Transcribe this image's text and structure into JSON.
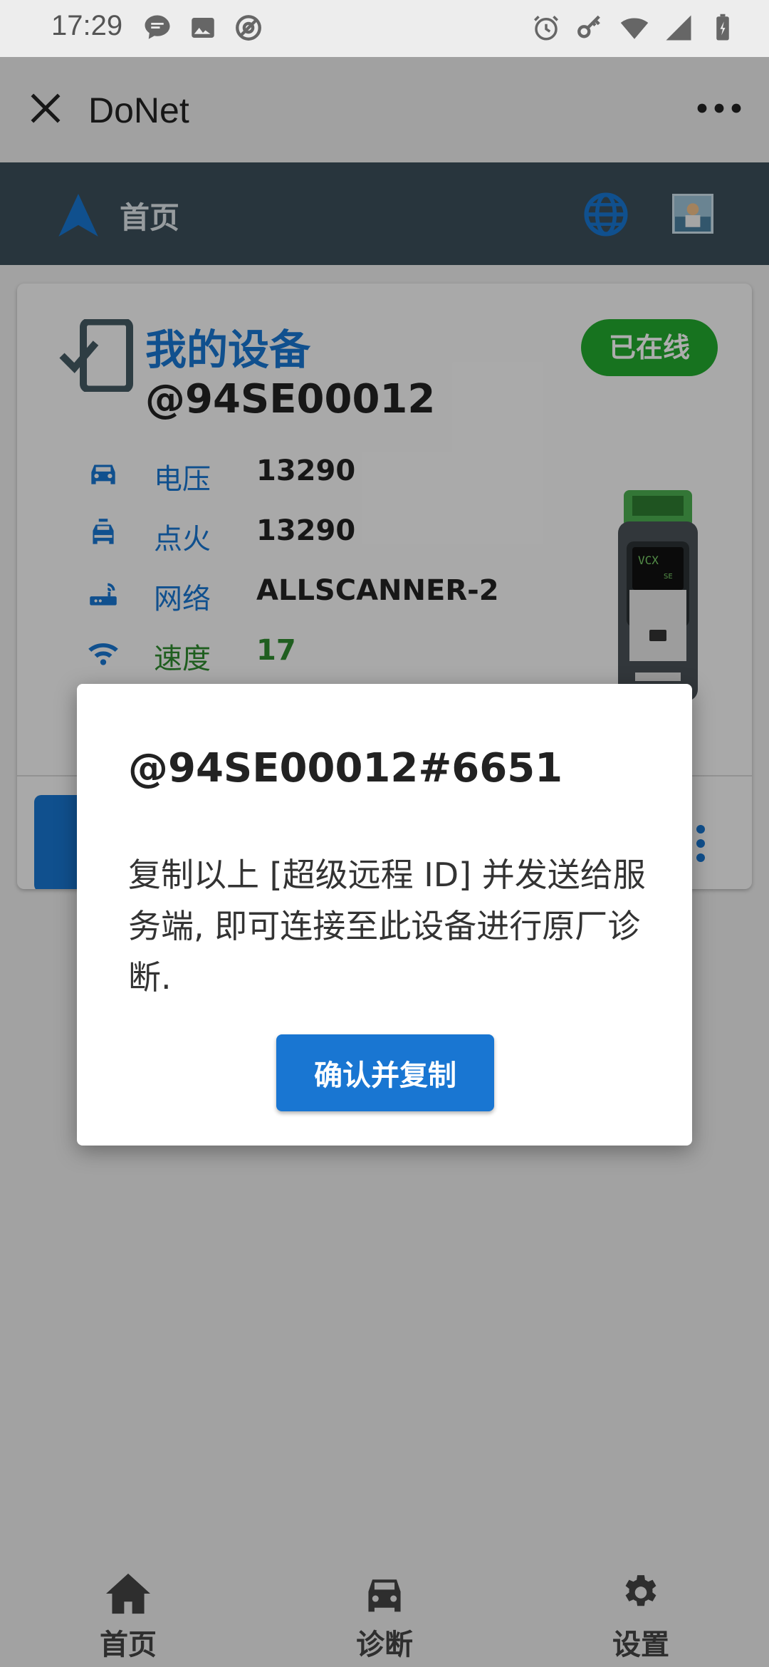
{
  "status_bar": {
    "time": "17:29",
    "left_icons": [
      "chat-bubble-icon",
      "image-icon",
      "at-sign-icon"
    ],
    "right_icons": [
      "alarm-icon",
      "key-icon",
      "wifi-icon",
      "signal-icon",
      "battery-charging-icon"
    ]
  },
  "title_bar": {
    "title": "DoNet"
  },
  "app_header": {
    "title": "首页",
    "accent": "#1976d2"
  },
  "device_card": {
    "title": "我的设备",
    "device_id": "@94SE00012",
    "status": "已在线",
    "rows": [
      {
        "icon": "car-icon",
        "label": "电压",
        "value": "13290"
      },
      {
        "icon": "car-ignition-icon",
        "label": "点火",
        "value": "13290"
      },
      {
        "icon": "router-icon",
        "label": "网络",
        "value": "ALLSCANNER-2"
      },
      {
        "icon": "wifi-icon",
        "label": "速度",
        "value": "17"
      }
    ]
  },
  "dialog": {
    "title": "@94SE00012#6651",
    "body": "复制以上 [超级远程 ID] 并发送给服务端, 即可连接至此设备进行原厂诊断.",
    "confirm_label": "确认并复制"
  },
  "bottom_nav": [
    {
      "icon": "home-icon",
      "label": "首页"
    },
    {
      "icon": "car-icon",
      "label": "诊断"
    },
    {
      "icon": "gear-icon",
      "label": "设置"
    }
  ]
}
